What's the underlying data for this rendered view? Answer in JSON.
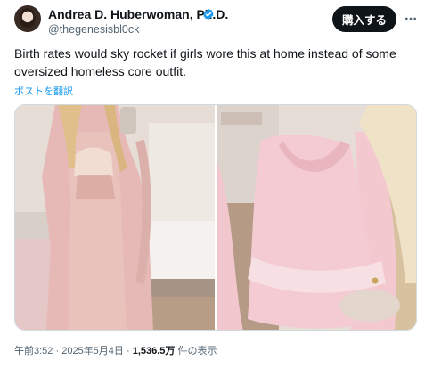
{
  "author": {
    "display_name": "Andrea D. Huberwoman, Ph.D.",
    "handle": "@thegenesisbl0ck",
    "verified": true
  },
  "header": {
    "subscribe_label": "購入する",
    "more_icon": "more-horizontal-icon"
  },
  "tweet": {
    "text": "Birth rates would sky rocket if girls wore this at home instead of some oversized homeless core outfit.",
    "translate_label": "ポストを翻訳"
  },
  "media": {
    "count": 2
  },
  "meta": {
    "time": "午前3:52",
    "separator1": " · ",
    "date": "2025年5月4日",
    "separator2": " · ",
    "views_count": "1,536.5万",
    "views_label": " 件の表示"
  },
  "colors": {
    "accent": "#1d9bf0",
    "text_primary": "#0f1419",
    "text_secondary": "#536471",
    "button_bg": "#0f1419"
  }
}
